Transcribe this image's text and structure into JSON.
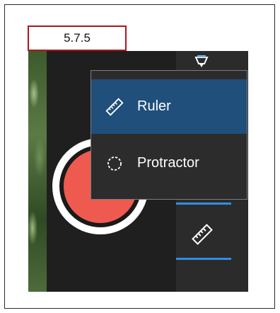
{
  "step_label": "5.7.5",
  "menu": {
    "items": [
      {
        "label": "Ruler",
        "icon": "ruler-icon",
        "selected": true
      },
      {
        "label": "Protractor",
        "icon": "protractor-icon",
        "selected": false
      }
    ]
  },
  "colors": {
    "step_border": "#b3131b",
    "selected_bg": "#1f4f7a",
    "menu_bg": "#2c2c2c",
    "capture_button": "#ef5a50",
    "accent": "#2f8ee6"
  },
  "toolbar": {
    "top_tool_icon": "pen-icon",
    "bottom_tool_icon": "ruler-icon"
  },
  "capture_button_icon": "record-button"
}
